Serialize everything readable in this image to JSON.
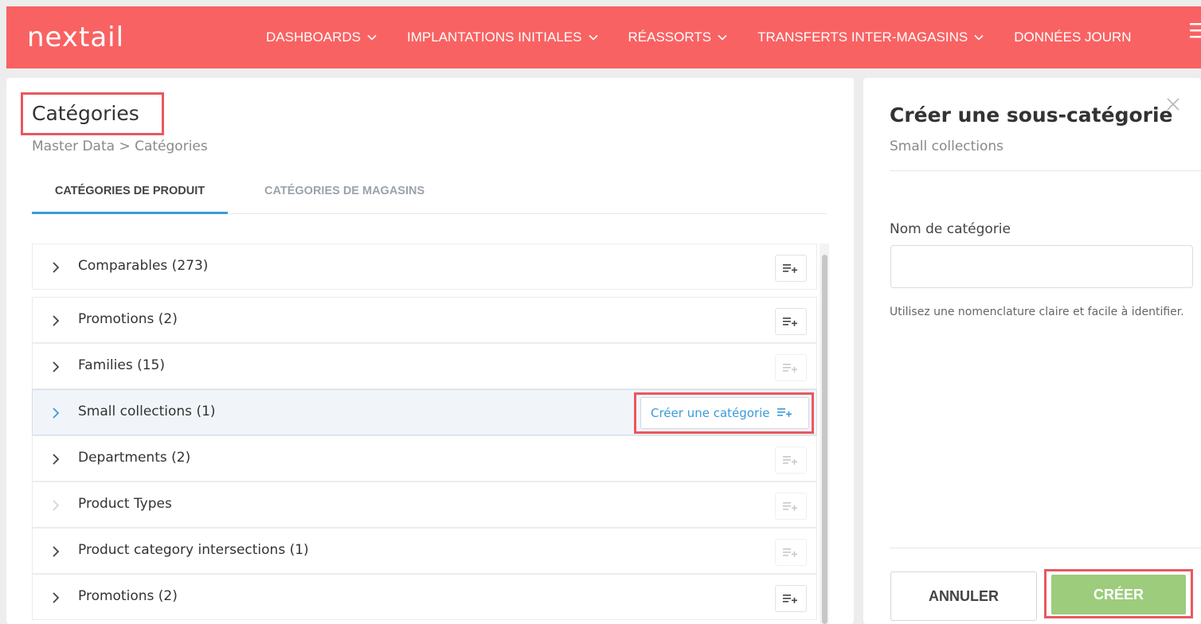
{
  "app": {
    "logo_text": "nextail",
    "nav": [
      {
        "label": "DASHBOARDS"
      },
      {
        "label": "IMPLANTATIONS INITIALES"
      },
      {
        "label": "RÉASSORTS"
      },
      {
        "label": "TRANSFERTS INTER-MAGASINS"
      },
      {
        "label": "DONNÉES JOURN"
      }
    ]
  },
  "page": {
    "title": "Catégories",
    "breadcrumb": "Master Data > Catégories",
    "tabs": [
      {
        "label": "CATÉGORIES DE PRODUIT",
        "active": true
      },
      {
        "label": "CATÉGORIES DE MAGASINS",
        "active": false
      }
    ]
  },
  "categories": [
    {
      "label": "Comparables (273)"
    },
    {
      "label": "Promotions (2)"
    },
    {
      "label": "Families (15)"
    },
    {
      "label": "Small collections (1)",
      "selected": true
    },
    {
      "label": "Departments (2)"
    },
    {
      "label": "Product Types"
    },
    {
      "label": "Product category intersections (1)"
    },
    {
      "label": "Promotions (2)"
    }
  ],
  "row_action": {
    "create_label": "Créer une catégorie"
  },
  "drawer": {
    "title": "Créer une sous-catégorie",
    "subtitle": "Small collections",
    "field_label": "Nom de catégorie",
    "field_value": "",
    "field_hint": "Utilisez une nomenclature claire et facile à identifier.",
    "cancel_label": "ANNULER",
    "create_label": "CRÉER"
  },
  "colors": {
    "brand": "#f96262",
    "accent": "#3a9bd9",
    "create_button": "#9ccc7c",
    "highlight": "#e8585e"
  }
}
